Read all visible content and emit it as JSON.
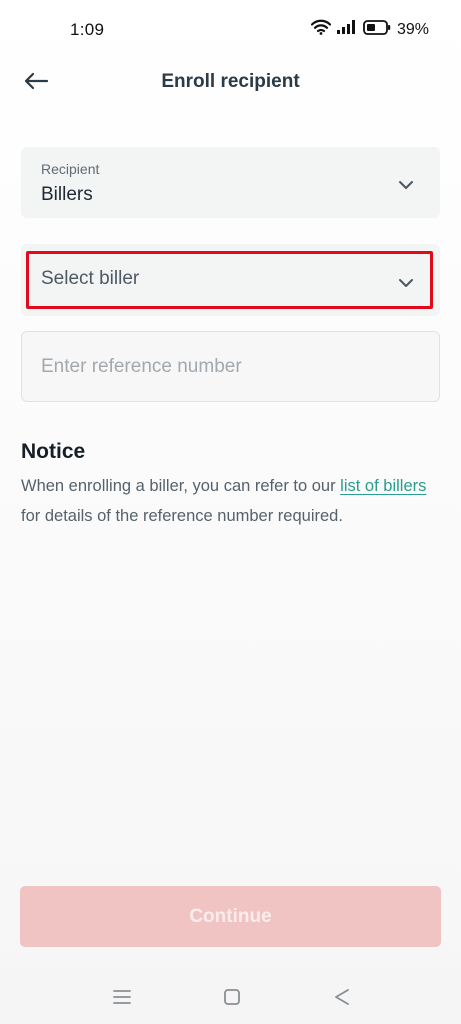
{
  "status_bar": {
    "time": "1:09",
    "battery": "39%",
    "icons": [
      "wifi-icon",
      "signal-icon",
      "battery-icon"
    ]
  },
  "header": {
    "title": "Enroll recipient",
    "back_icon": "arrow-left-icon"
  },
  "recipient": {
    "label": "Recipient",
    "value": "Billers"
  },
  "biller": {
    "placeholder": "Select biller",
    "highlight_color": "#e3091a"
  },
  "reference": {
    "placeholder": "Enter reference number",
    "value": ""
  },
  "notice": {
    "heading": "Notice",
    "text_before": "When enrolling a biller, you can refer to our ",
    "link_text": "list of billers",
    "text_after": " for details of the reference number required.",
    "link_color": "#2a9d8f"
  },
  "continue": {
    "label": "Continue",
    "disabled": true,
    "color": "#f1c4c4"
  },
  "nav_bar": {
    "icons": [
      "menu-icon",
      "home-square-icon",
      "back-triangle-icon"
    ]
  }
}
